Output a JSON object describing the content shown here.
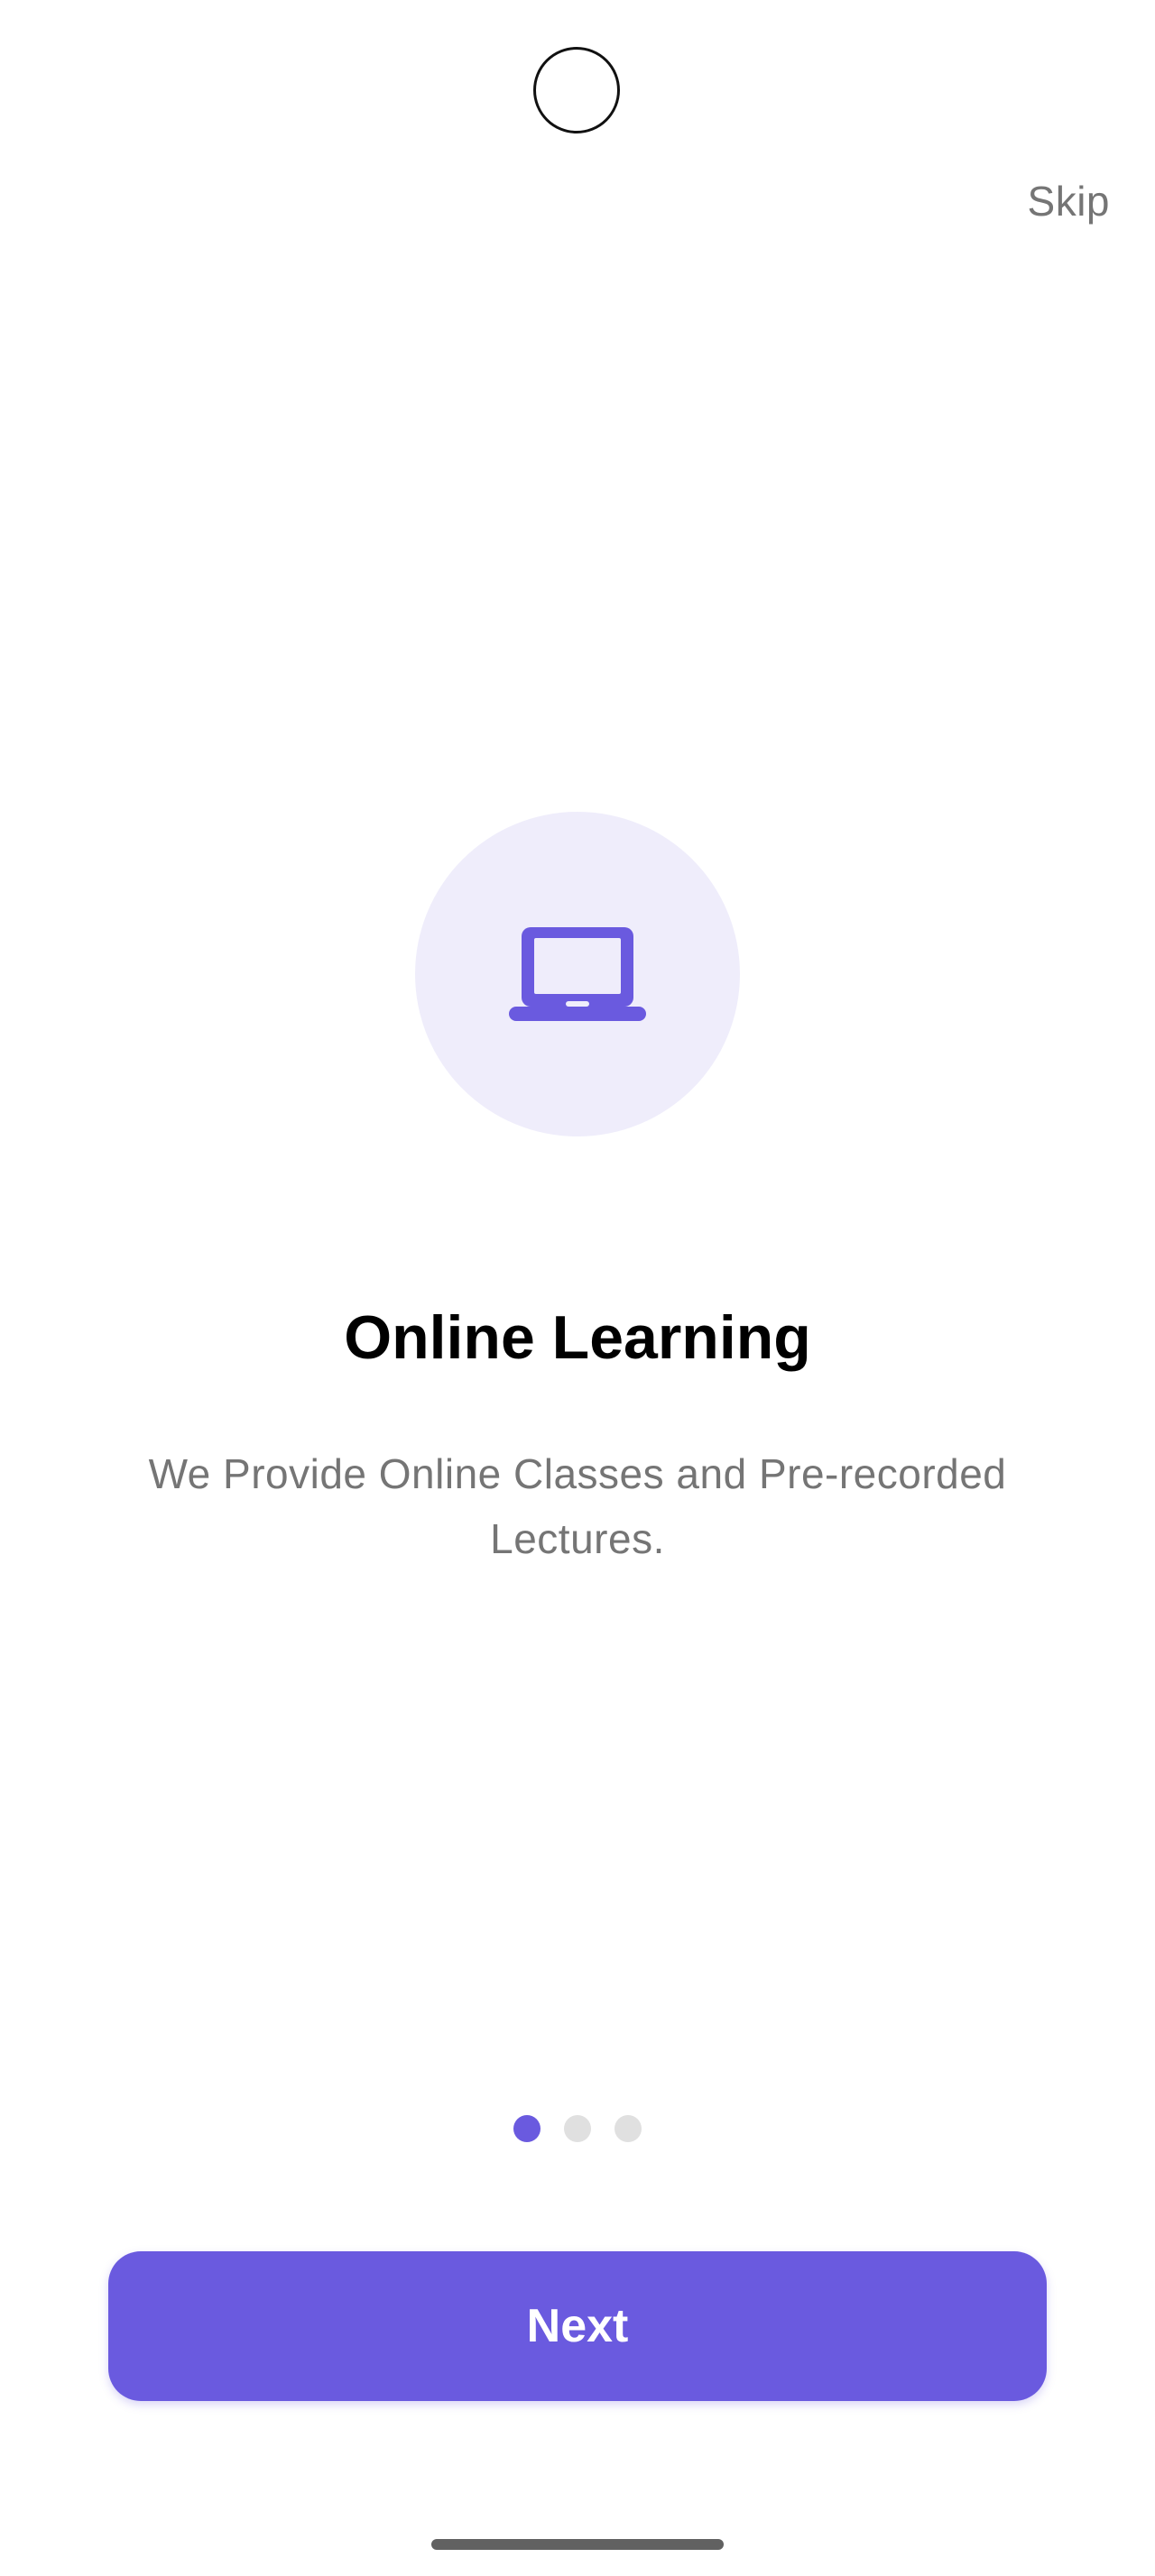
{
  "onboarding": {
    "skip_label": "Skip",
    "illustration_icon": "laptop-icon",
    "title": "Online Learning",
    "description": "We Provide Online Classes and Pre-recorded Lectures.",
    "page_indicator": {
      "current_page": 1,
      "total_pages": 3
    },
    "next_label": "Next"
  },
  "colors": {
    "accent": "#6a5adf",
    "illustration_background": "#efedfb",
    "inactive_dot": "#e0e0e0",
    "secondary_text": "#757575"
  }
}
